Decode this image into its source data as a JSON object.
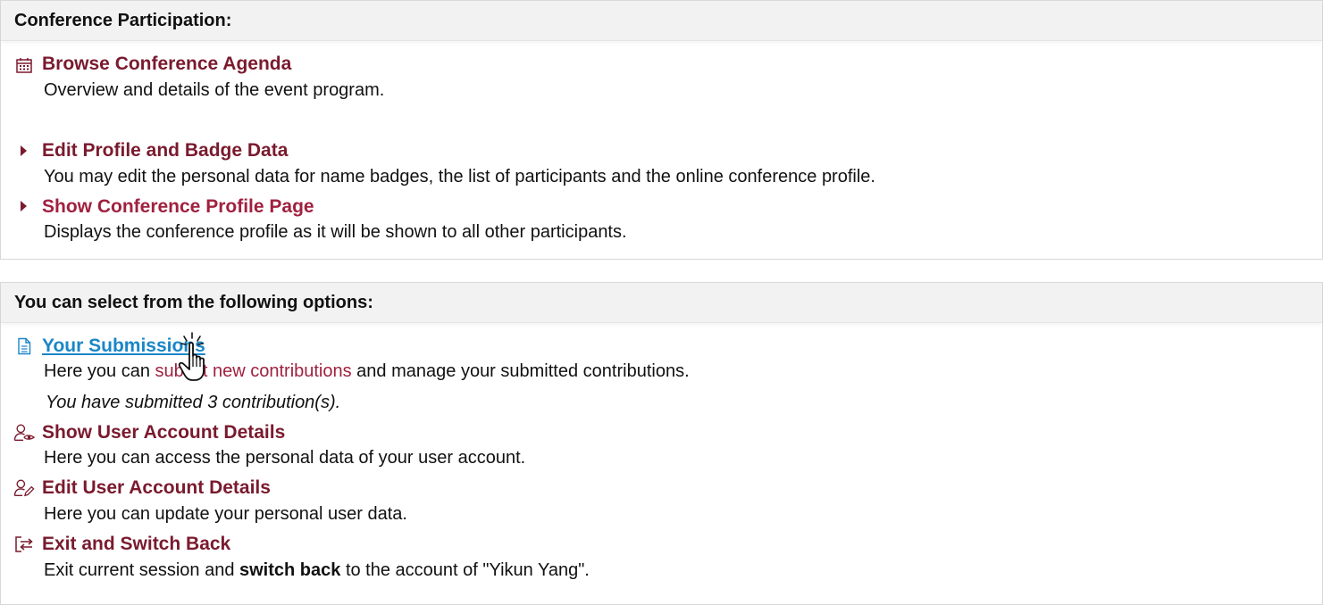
{
  "section1": {
    "header": "Conference Participation:",
    "items": [
      {
        "icon": "calendar-icon",
        "title": "Browse Conference Agenda",
        "desc": "Overview and details of the event program."
      },
      {
        "icon": "caret-right-icon",
        "title": "Edit Profile and Badge Data",
        "desc": "You may edit the personal data for name badges, the list of participants and the online conference profile."
      },
      {
        "icon": "caret-right-icon",
        "title": "Show Conference Profile Page",
        "desc": "Displays the conference profile as it will be shown to all other participants."
      }
    ]
  },
  "section2": {
    "header": "You can select from the following options:",
    "submissions": {
      "icon": "document-icon",
      "title": "Your Submissions",
      "desc_before": "Here you can ",
      "desc_link": "submit new contributions",
      "desc_after": " and manage your submitted contributions.",
      "note": "You have submitted 3 contribution(s)."
    },
    "show_account": {
      "icon": "user-eye-icon",
      "title": "Show User Account Details",
      "desc": "Here you can access the personal data of your user account."
    },
    "edit_account": {
      "icon": "user-edit-icon",
      "title": "Edit User Account Details",
      "desc": "Here you can update your personal user data."
    },
    "exit": {
      "icon": "switch-icon",
      "title": "Exit and Switch Back",
      "desc_before": "Exit current session and ",
      "desc_bold": "switch back",
      "desc_after": " to the account of \"Yikun Yang\"."
    }
  },
  "colors": {
    "title": "#7a1a2e",
    "title_light": "#a0213f",
    "link": "#1a86c7",
    "header_bg": "#f2f2f2"
  }
}
